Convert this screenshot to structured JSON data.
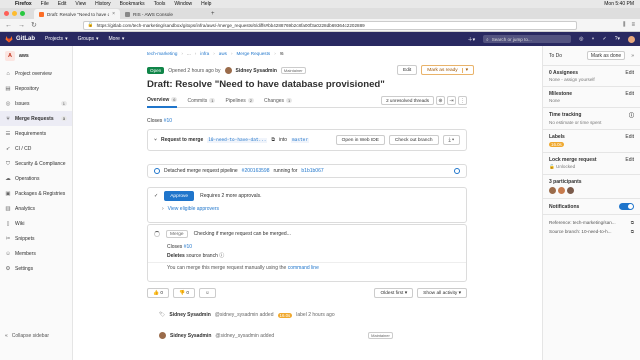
{
  "macbar": {
    "app": "Firefox",
    "menus": [
      "File",
      "Edit",
      "View",
      "History",
      "Bookmarks",
      "Tools",
      "Window",
      "Help"
    ],
    "right": "Mon 5:40 PM"
  },
  "tabs": [
    {
      "title": "Draft: Resolve \"Need to have data",
      "active": true
    },
    {
      "title": "RIS - AWS Console",
      "active": false
    }
  ],
  "url": "https://gitlab.com/tech-marketing/sandbox/gitops/infra/aws/-/merge_requests/6/diffs#bb4288769b2c8fa00f3a0228db69364c2202889",
  "gitlab": {
    "brand": "GitLab",
    "nav": [
      "Projects",
      "Groups",
      "More"
    ],
    "search_placeholder": "Search or jump to..."
  },
  "sidebar": {
    "project_initial": "A",
    "project_name": "aws",
    "items": [
      {
        "label": "Project overview",
        "icon": "home-icon"
      },
      {
        "label": "Repository",
        "icon": "doc-icon"
      },
      {
        "label": "Issues",
        "icon": "issues-icon",
        "count": "1"
      },
      {
        "label": "Merge Requests",
        "icon": "merge-icon",
        "count": "3",
        "active": true
      },
      {
        "label": "Requirements",
        "icon": "list-icon"
      },
      {
        "label": "CI / CD",
        "icon": "rocket-icon"
      },
      {
        "label": "Security & Compliance",
        "icon": "shield-icon"
      },
      {
        "label": "Operations",
        "icon": "cloud-icon"
      },
      {
        "label": "Packages & Registries",
        "icon": "package-icon"
      },
      {
        "label": "Analytics",
        "icon": "chart-icon"
      },
      {
        "label": "Wiki",
        "icon": "book-icon"
      },
      {
        "label": "Snippets",
        "icon": "snippet-icon"
      },
      {
        "label": "Members",
        "icon": "users-icon"
      },
      {
        "label": "Settings",
        "icon": "gear-icon"
      }
    ],
    "collapse": "Collapse sidebar"
  },
  "breadcrumbs": [
    "tech-marketing",
    "...",
    "infra",
    "aws",
    "Merge Requests",
    "!6"
  ],
  "mr": {
    "status": "Open",
    "opened": "Opened 2 hours ago by",
    "author": "Sidney Sysadmin",
    "role": "Maintainer",
    "edit": "Edit",
    "mark_ready": "Mark as ready",
    "title": "Draft: Resolve \"Need to have database provisioned\"",
    "tabs": [
      {
        "label": "Overview",
        "count": "6"
      },
      {
        "label": "Commits",
        "count": "1"
      },
      {
        "label": "Pipelines",
        "count": "2"
      },
      {
        "label": "Changes",
        "count": "1"
      }
    ],
    "unresolved": "2 unresolved threads",
    "closes_prefix": "Closes",
    "closes_issue": "#10",
    "request_label": "Request to merge",
    "source_branch": "10-need-to-have-dat...",
    "into_label": "into",
    "target_branch": "master",
    "open_web_ide": "Open in Web IDE",
    "checkout": "Check out branch",
    "pipeline_text_1": "Detached merge request pipeline",
    "pipeline_id": "#200163598",
    "pipeline_text_2": "running for",
    "pipeline_commit": "b1b1b067",
    "approve": "Approve",
    "approvals_required": "Requires 2 more approvals.",
    "view_approvers": "View eligible approvers",
    "merge_btn": "Merge",
    "merge_checking": "Checking if merge request can be merged...",
    "merge_closes": "Closes",
    "merge_closes_issue": "#10",
    "deletes_source": "Deletes",
    "deletes_rest": "source branch",
    "manual_merge": "You can merge this merge request manually using the",
    "command_line": "command line",
    "thumbs_up": "0",
    "thumbs_down": "0",
    "oldest_first": "Oldest first",
    "show_all": "Show all activity",
    "activity_user": "Sidney Sysadmin",
    "activity_handle": "@sidney_sysadmin added",
    "activity_label": "16.0s",
    "activity_rest": "label 2 hours ago"
  },
  "right_sidebar": {
    "todo": "To Do",
    "mark_done": "Mark as done",
    "blocks": [
      {
        "title": "0 Assignees",
        "edit": "Edit",
        "value": "None - assign yourself"
      },
      {
        "title": "Milestone",
        "edit": "Edit",
        "value": "None"
      },
      {
        "title": "Time tracking",
        "edit": "",
        "value": "No estimate or time spent"
      },
      {
        "title": "Labels",
        "edit": "Edit",
        "value": ""
      },
      {
        "title": "Lock merge request",
        "edit": "Edit",
        "value": "Unlocked"
      },
      {
        "title": "3 participants",
        "edit": "",
        "value": ""
      }
    ],
    "label_chip": "16.0s",
    "notifications": "Notifications",
    "reference": "Reference: tech-marketing/san...",
    "source_branch": "Source branch: 10-need-to-h..."
  },
  "colors": {
    "nav_bg": "#292961",
    "accent": "#1f75cb",
    "open_green": "#108548",
    "warning": "#e9b36a"
  }
}
